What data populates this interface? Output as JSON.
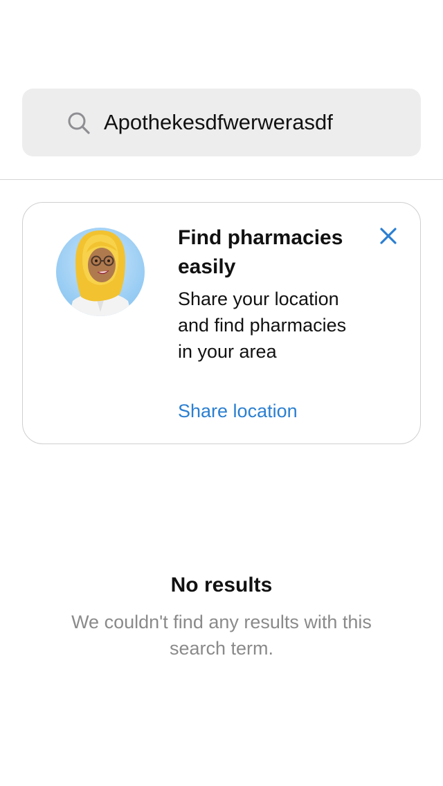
{
  "search": {
    "value": "Apothekesdfwerwerasdf",
    "icon": "search-icon"
  },
  "location_card": {
    "title": "Find pharmacies easily",
    "description": "Share your location and find pharmacies in your area",
    "link_label": "Share location",
    "close_icon": "close-icon",
    "avatar": "pharmacist-avatar",
    "accent_color": "#2b7fd1"
  },
  "empty_state": {
    "title": "No results",
    "message": "We couldn't find any results with this search term."
  }
}
